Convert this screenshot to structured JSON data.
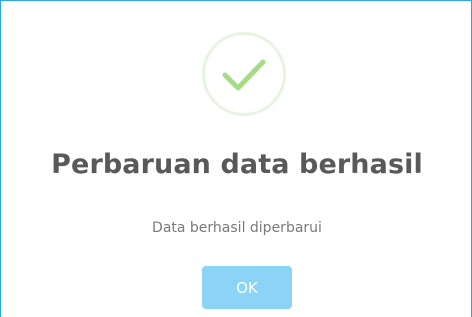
{
  "dialog": {
    "icon": "check-icon",
    "title": "Perbaruan data berhasil",
    "message": "Data berhasil diperbarui",
    "ok_label": "OK"
  },
  "colors": {
    "frame_border": "#2fa6df",
    "icon_ring": "#e6f4e1",
    "check_mark": "#a5dc86",
    "title_text": "#595959",
    "message_text": "#7a7a7a",
    "button_bg": "#8cd4f5",
    "button_text": "#ffffff"
  }
}
